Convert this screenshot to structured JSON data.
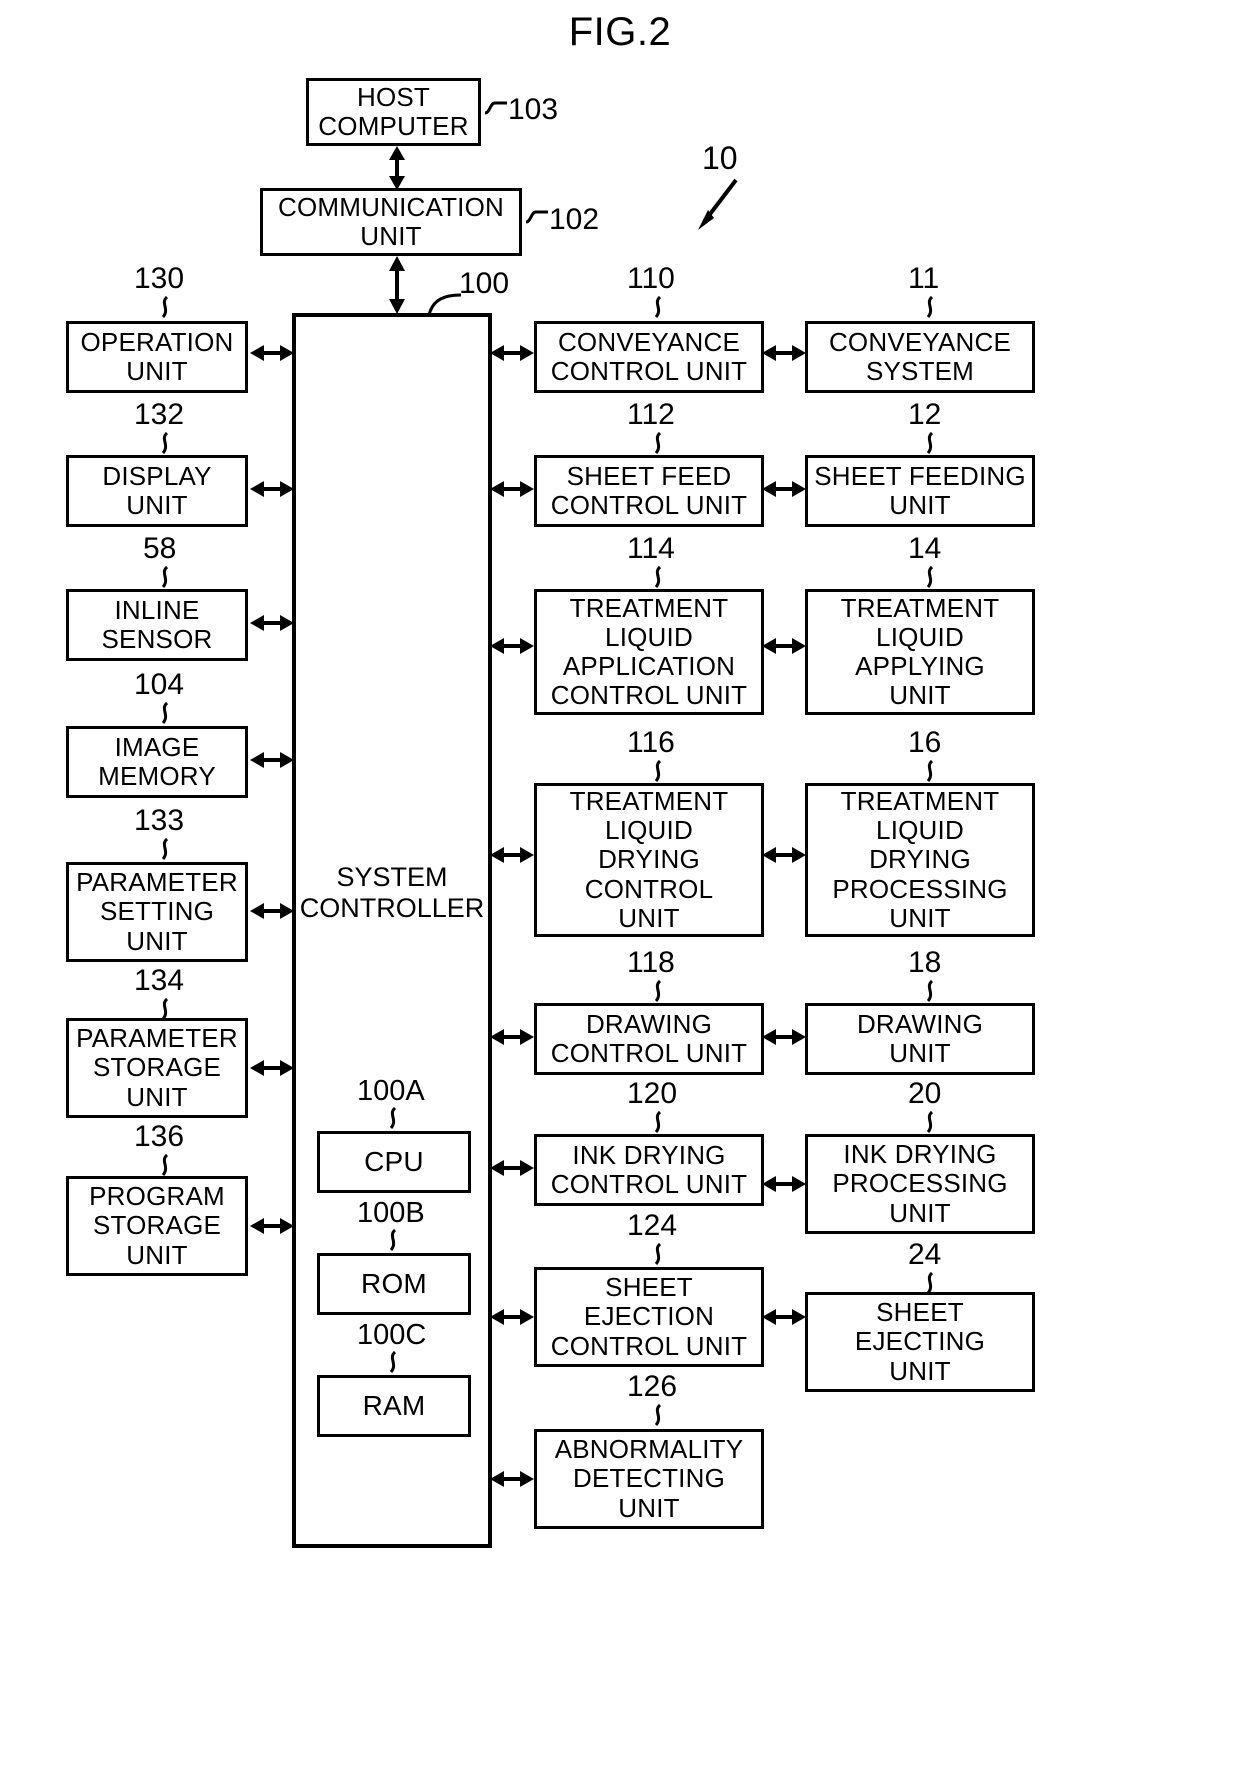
{
  "figure": {
    "title": "FIG.2",
    "system_ref": "10"
  },
  "top_chain": [
    {
      "label": "HOST\nCOMPUTER",
      "ref": "103"
    },
    {
      "label": "COMMUNICATION\nUNIT",
      "ref": "102"
    }
  ],
  "controller": {
    "label": "SYSTEM\nCONTROLLER",
    "ref": "100",
    "submodules": [
      {
        "label": "CPU",
        "ref": "100A"
      },
      {
        "label": "ROM",
        "ref": "100B"
      },
      {
        "label": "RAM",
        "ref": "100C"
      }
    ]
  },
  "left_column": [
    {
      "label": "OPERATION\nUNIT",
      "ref": "130"
    },
    {
      "label": "DISPLAY\nUNIT",
      "ref": "132"
    },
    {
      "label": "INLINE\nSENSOR",
      "ref": "58"
    },
    {
      "label": "IMAGE\nMEMORY",
      "ref": "104"
    },
    {
      "label": "PARAMETER\nSETTING\nUNIT",
      "ref": "133"
    },
    {
      "label": "PARAMETER\nSTORAGE\nUNIT",
      "ref": "134"
    },
    {
      "label": "PROGRAM\nSTORAGE\nUNIT",
      "ref": "136"
    }
  ],
  "control_column": [
    {
      "label": "CONVEYANCE\nCONTROL UNIT",
      "ref": "110"
    },
    {
      "label": "SHEET FEED\nCONTROL UNIT",
      "ref": "112"
    },
    {
      "label": "TREATMENT\nLIQUID\nAPPLICATION\nCONTROL UNIT",
      "ref": "114"
    },
    {
      "label": "TREATMENT\nLIQUID\nDRYING\nCONTROL\nUNIT",
      "ref": "116"
    },
    {
      "label": "DRAWING\nCONTROL UNIT",
      "ref": "118"
    },
    {
      "label": "INK DRYING\nCONTROL UNIT",
      "ref": "120"
    },
    {
      "label": "SHEET\nEJECTION\nCONTROL UNIT",
      "ref": "124"
    },
    {
      "label": "ABNORMALITY\nDETECTING\nUNIT",
      "ref": "126"
    }
  ],
  "device_column": [
    {
      "label": "CONVEYANCE\nSYSTEM",
      "ref": "11"
    },
    {
      "label": "SHEET FEEDING\nUNIT",
      "ref": "12"
    },
    {
      "label": "TREATMENT\nLIQUID\nAPPLYING\nUNIT",
      "ref": "14"
    },
    {
      "label": "TREATMENT\nLIQUID\nDRYING\nPROCESSING\nUNIT",
      "ref": "16"
    },
    {
      "label": "DRAWING\nUNIT",
      "ref": "18"
    },
    {
      "label": "INK DRYING\nPROCESSING\nUNIT",
      "ref": "20"
    },
    {
      "label": "SHEET\nEJECTING\nUNIT",
      "ref": "24"
    }
  ]
}
